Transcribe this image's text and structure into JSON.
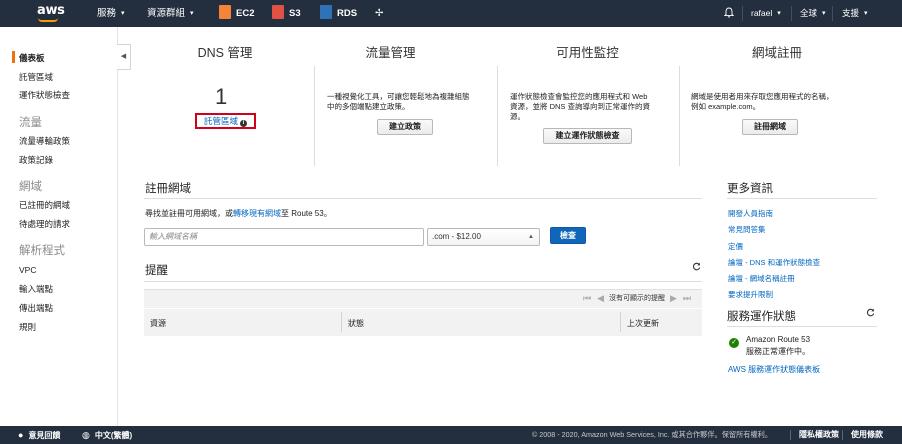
{
  "topnav": {
    "services": "服務",
    "resource_groups": "資源群組",
    "ec2": "EC2",
    "s3": "S3",
    "rds": "RDS",
    "user": "rafael",
    "region": "全球",
    "support": "支援",
    "colors": {
      "ec2": "#f58536",
      "s3": "#e05243",
      "rds": "#2e73b8",
      "bar": "#232f3e"
    }
  },
  "sidebar": {
    "items": [
      {
        "label": "儀表板",
        "active": true
      },
      {
        "label": "託管區域"
      },
      {
        "label": "運作狀態檢查"
      }
    ],
    "traffic": {
      "title": "流量",
      "items": [
        "流量導輪政策",
        "政策記錄"
      ]
    },
    "domains": {
      "title": "網域",
      "items": [
        "已註冊的網域",
        "待處理的請求"
      ]
    },
    "resolver": {
      "title": "解析程式",
      "items": [
        "VPC",
        "輸入端點",
        "傳出端點",
        "規則"
      ]
    }
  },
  "dashboard": {
    "dns": {
      "title": "DNS 管理",
      "count": "1",
      "link": "託管區域"
    },
    "traffic": {
      "title": "流量管理",
      "desc1": "一種視覺化工具，可讓您輕鬆地為複雜組態",
      "desc2": "中的多個端點建立政策。",
      "button": "建立政策"
    },
    "availability": {
      "title": "可用性監控",
      "desc1": "運作狀態檢查會監控您的應用程式和 Web",
      "desc2": "資源，並將 DNS 查詢導向到正常運作的資",
      "desc3": "源。",
      "button": "建立運作狀態檢查"
    },
    "domain_reg": {
      "title": "網域註冊",
      "desc1": "網域是使用者用來存取您應用程式的名稱，",
      "desc2": "例如 example.com。",
      "button": "註冊網域"
    }
  },
  "register": {
    "title": "註冊網域",
    "desc_prefix": "尋找並註冊可用網域，或",
    "desc_link": "轉移現有網域",
    "desc_suffix": "至 Route 53。",
    "input_placeholder": "輸入網域名稱",
    "tld": ".com - $12.00",
    "check_button": "檢查"
  },
  "alerts": {
    "title": "提醒",
    "pager_text": "沒有可顯示的提醒",
    "columns": [
      "資源",
      "狀態",
      "上次更新"
    ]
  },
  "more_info": {
    "title": "更多資訊",
    "links": [
      "開發人員指南",
      "常見問答集",
      "定價",
      "論壇 - DNS 和運作狀態檢查",
      "論壇 - 網域名稱註冊",
      "要求提升限制"
    ]
  },
  "service_health": {
    "title": "服務運作狀態",
    "service": "Amazon Route 53",
    "status": "服務正常運作中。",
    "dashboard_link": "AWS 服務運作狀態儀表板"
  },
  "footer": {
    "feedback": "意見回饋",
    "language": "中文(繁體)",
    "copyright": "© 2008 - 2020, Amazon Web Services, Inc. 或其合作夥伴。保留所有權利。",
    "privacy": "隱私權政策",
    "terms": "使用條款"
  }
}
